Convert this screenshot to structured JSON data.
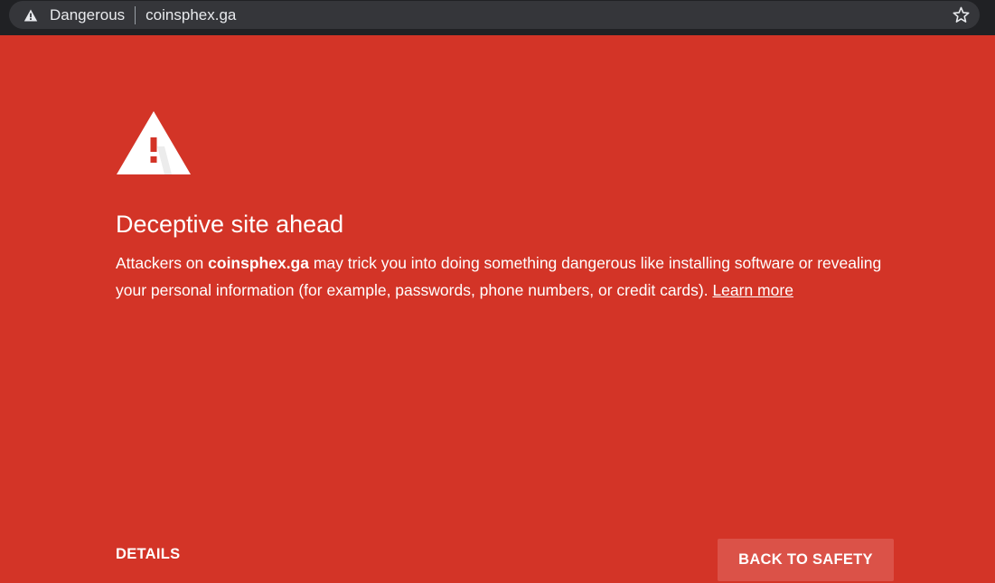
{
  "browser": {
    "security_label": "Dangerous",
    "url": "coinsphex.ga",
    "icons": {
      "security": "warning-triangle-icon",
      "bookmark": "star-icon"
    }
  },
  "interstitial": {
    "heading": "Deceptive site ahead",
    "body_prefix": "Attackers on ",
    "body_domain": "coinsphex.ga",
    "body_suffix": " may trick you into doing something dangerous like installing software or revealing your personal information (for example, passwords, phone numbers, or credit cards). ",
    "learn_more": "Learn more",
    "details_button": "DETAILS",
    "primary_button": "BACK TO SAFETY",
    "icon": "warning-triangle-icon"
  },
  "colors": {
    "background": "#d33427",
    "toolbar": "#202124",
    "omnibox": "#35363a",
    "primary_button": "#db5248",
    "text": "#ffffff"
  }
}
